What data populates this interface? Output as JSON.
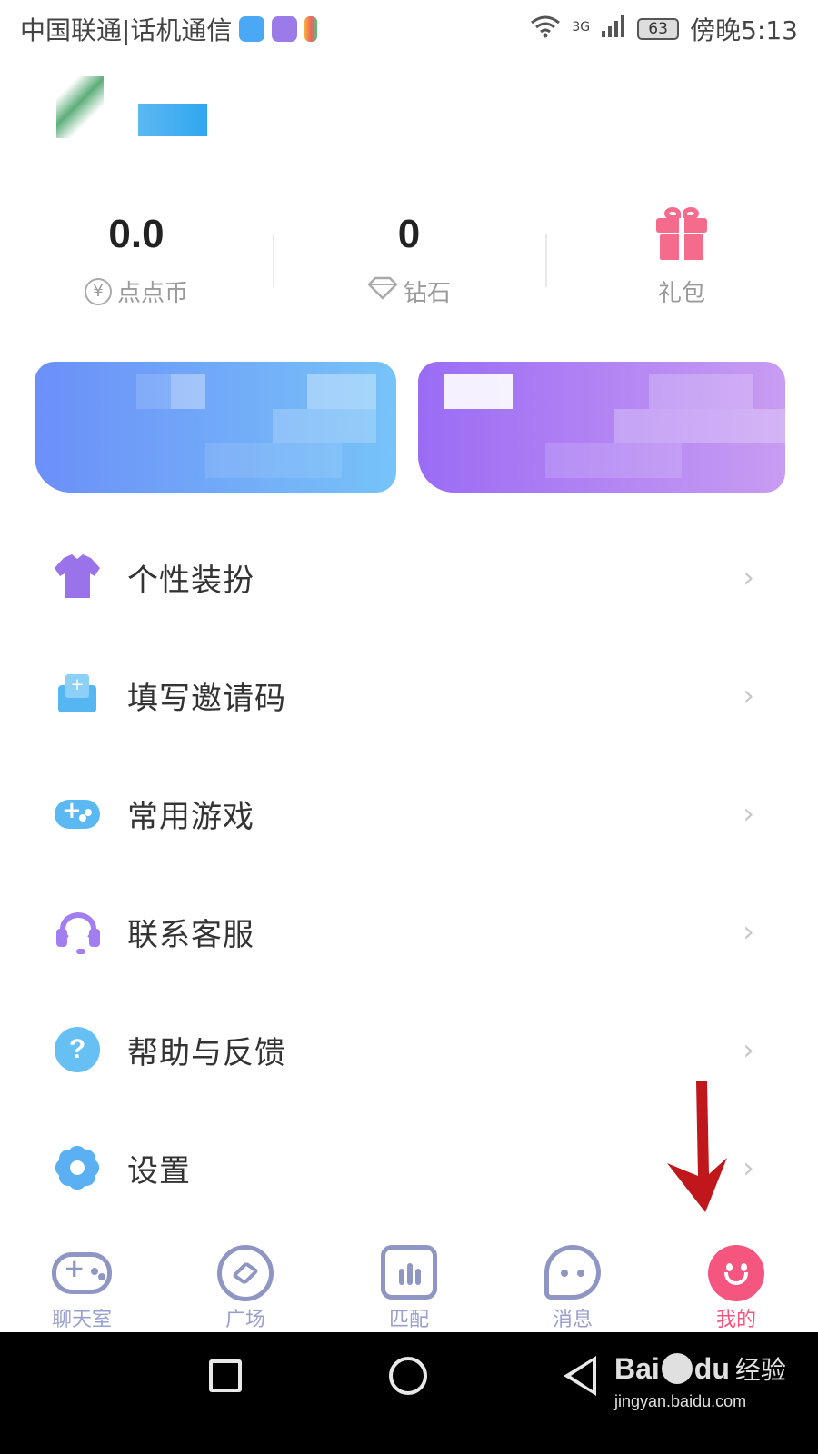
{
  "status_bar": {
    "carrier": "中国联通|话机通信",
    "network": "3G",
    "battery": "63",
    "time": "傍晚5:13"
  },
  "stats": [
    {
      "value": "0.0",
      "label": "点点币",
      "icon": "coin-icon"
    },
    {
      "value": "0",
      "label": "钻石",
      "icon": "diamond-icon"
    },
    {
      "value": "",
      "label": "礼包",
      "icon": "gift-icon"
    }
  ],
  "menu": [
    {
      "label": "个性装扮",
      "icon": "shirt-icon"
    },
    {
      "label": "填写邀请码",
      "icon": "mail-icon"
    },
    {
      "label": "常用游戏",
      "icon": "gamepad-icon"
    },
    {
      "label": "联系客服",
      "icon": "headset-icon"
    },
    {
      "label": "帮助与反馈",
      "icon": "help-icon"
    },
    {
      "label": "设置",
      "icon": "gear-icon"
    }
  ],
  "tabs": [
    {
      "label": "聊天室",
      "icon": "gamepad-icon",
      "active": false
    },
    {
      "label": "广场",
      "icon": "compass-icon",
      "active": false
    },
    {
      "label": "匹配",
      "icon": "match-icon",
      "active": false
    },
    {
      "label": "消息",
      "icon": "chat-bubble-icon",
      "active": false
    },
    {
      "label": "我的",
      "icon": "smiley-icon",
      "active": true
    }
  ],
  "watermark": {
    "brand": "Bai",
    "brand_suffix": "du",
    "brand_cn": "经验",
    "url": "jingyan.baidu.com"
  },
  "colors": {
    "accent_pink": "#f5567f",
    "tab_inactive": "#8f96c4",
    "annotation_red": "#c0171c"
  }
}
